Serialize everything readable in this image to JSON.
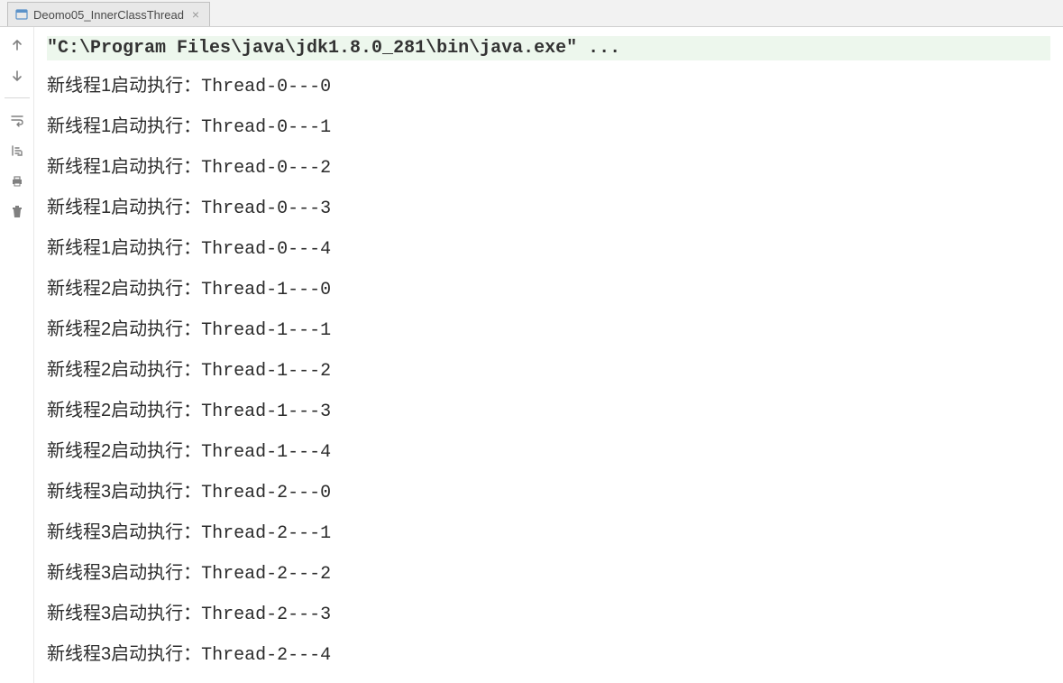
{
  "tab": {
    "label": "Deomo05_InnerClassThread"
  },
  "console": {
    "command": "\"C:\\Program Files\\java\\jdk1.8.0_281\\bin\\java.exe\" ...",
    "lines": [
      {
        "prefix": "新线程1启动执行：",
        "thread": "Thread-0---0"
      },
      {
        "prefix": "新线程1启动执行：",
        "thread": "Thread-0---1"
      },
      {
        "prefix": "新线程1启动执行：",
        "thread": "Thread-0---2"
      },
      {
        "prefix": "新线程1启动执行：",
        "thread": "Thread-0---3"
      },
      {
        "prefix": "新线程1启动执行：",
        "thread": "Thread-0---4"
      },
      {
        "prefix": "新线程2启动执行：",
        "thread": "Thread-1---0"
      },
      {
        "prefix": "新线程2启动执行：",
        "thread": "Thread-1---1"
      },
      {
        "prefix": "新线程2启动执行：",
        "thread": "Thread-1---2"
      },
      {
        "prefix": "新线程2启动执行：",
        "thread": "Thread-1---3"
      },
      {
        "prefix": "新线程2启动执行：",
        "thread": "Thread-1---4"
      },
      {
        "prefix": "新线程3启动执行：",
        "thread": "Thread-2---0"
      },
      {
        "prefix": "新线程3启动执行：",
        "thread": "Thread-2---1"
      },
      {
        "prefix": "新线程3启动执行：",
        "thread": "Thread-2---2"
      },
      {
        "prefix": "新线程3启动执行：",
        "thread": "Thread-2---3"
      },
      {
        "prefix": "新线程3启动执行：",
        "thread": "Thread-2---4"
      }
    ]
  }
}
